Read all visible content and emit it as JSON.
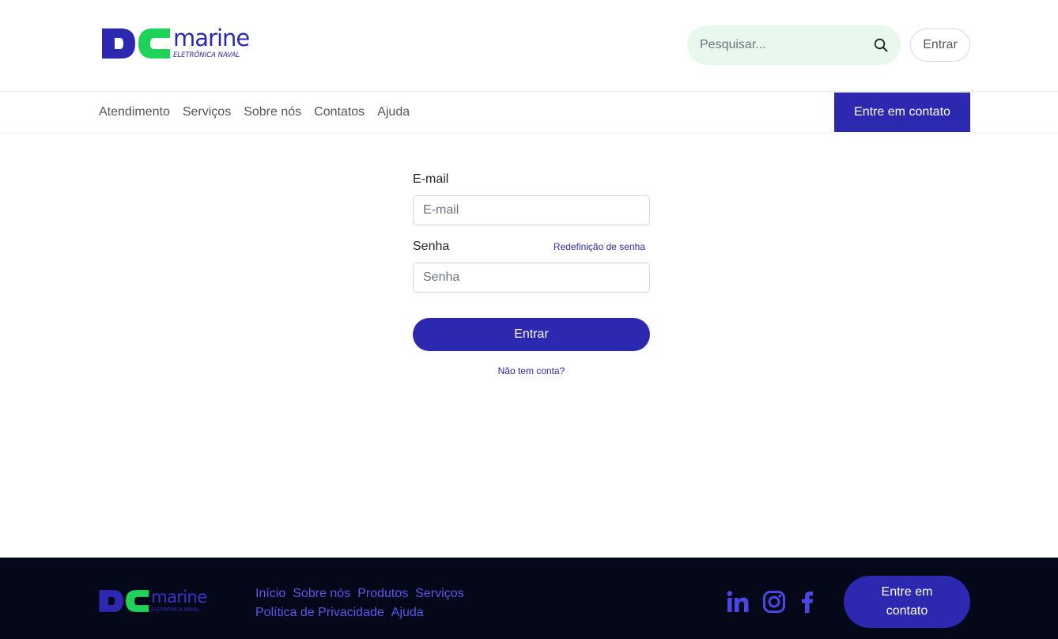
{
  "header": {
    "logo": {
      "text": "marine",
      "subtitle": "ELETRÔNICA NAVAL"
    },
    "search": {
      "placeholder": "Pesquisar..."
    },
    "login_label": "Entrar"
  },
  "nav": {
    "items": [
      {
        "label": "Atendimento"
      },
      {
        "label": "Serviços"
      },
      {
        "label": "Sobre nós"
      },
      {
        "label": "Contatos"
      },
      {
        "label": "Ajuda"
      }
    ],
    "contact_label": "Entre em contato"
  },
  "form": {
    "email_label": "E-mail",
    "email_placeholder": "E-mail",
    "password_label": "Senha",
    "reset_label": "Redefinição de senha",
    "password_placeholder": "Senha",
    "submit_label": "Entrar",
    "signup_label": "Não tem conta?"
  },
  "footer": {
    "links": [
      {
        "label": "Início"
      },
      {
        "label": "Sobre nós"
      },
      {
        "label": "Produtos"
      },
      {
        "label": "Serviços"
      },
      {
        "label": "Política de Privacidade"
      },
      {
        "label": "Ajuda"
      }
    ],
    "social_icons": [
      "linkedin-icon",
      "instagram-icon",
      "facebook-icon"
    ],
    "contact_label": "Entre em contato"
  },
  "colors": {
    "brand_blue": "#2d28b0",
    "brand_green": "#1fd35a",
    "footer_bg": "#040818",
    "footer_link": "#5c57ec",
    "search_bg": "#e8f8ec"
  }
}
